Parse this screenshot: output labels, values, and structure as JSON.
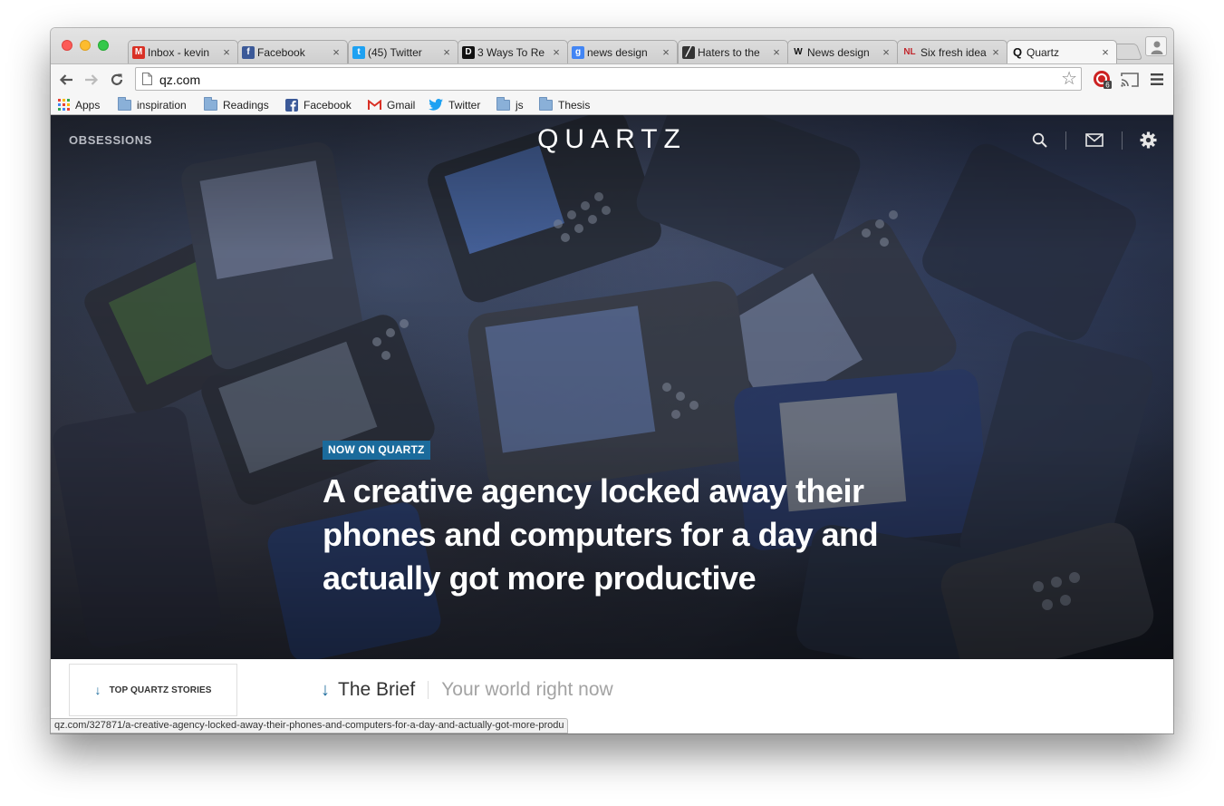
{
  "browser": {
    "tabs": [
      {
        "title": "Inbox - kevin",
        "favicon": "gmail-icon",
        "color": "#d93025",
        "glyph": "M"
      },
      {
        "title": "Facebook",
        "favicon": "facebook-icon",
        "color": "#3b5998",
        "glyph": "f"
      },
      {
        "title": "(45) Twitter",
        "favicon": "twitter-icon",
        "color": "#1da1f2",
        "glyph": "t"
      },
      {
        "title": "3 Ways To Re",
        "favicon": "d-logo-icon",
        "color": "#111111",
        "glyph": "D"
      },
      {
        "title": "news design",
        "favicon": "google-icon",
        "color": "#4285f4",
        "glyph": "g"
      },
      {
        "title": "Haters to the",
        "favicon": "stripe-logo-icon",
        "color": "#333333",
        "glyph": "╱"
      },
      {
        "title": "News design",
        "favicon": "wikipedia-icon",
        "color": "#ffffff",
        "glyph": "W"
      },
      {
        "title": "Six fresh idea",
        "favicon": "niemanlab-icon",
        "color": "#ffffff",
        "glyph": "NL"
      },
      {
        "title": "Quartz",
        "favicon": "quartz-icon",
        "color": "#ffffff",
        "glyph": "Q"
      }
    ],
    "active_tab_index": 8,
    "url": "qz.com",
    "extension_badge": "6",
    "bookmarks": [
      {
        "label": "Apps",
        "icon": "apps-grid-icon"
      },
      {
        "label": "inspiration",
        "icon": "folder-icon"
      },
      {
        "label": "Readings",
        "icon": "folder-icon"
      },
      {
        "label": "Facebook",
        "icon": "facebook-icon"
      },
      {
        "label": "Gmail",
        "icon": "gmail-icon"
      },
      {
        "label": "Twitter",
        "icon": "twitter-icon"
      },
      {
        "label": "js",
        "icon": "folder-icon"
      },
      {
        "label": "Thesis",
        "icon": "folder-icon"
      }
    ],
    "status_url": "qz.com/327871/a-creative-agency-locked-away-their-phones-and-computers-for-a-day-and-actually-got-more-produ"
  },
  "site": {
    "obsessions_label": "OBSESSIONS",
    "logo": "QUARTZ",
    "kicker": "NOW ON QUARTZ",
    "headline": "A creative agency locked away their phones and computers for a day and actually got more productive",
    "top_stories_label": "TOP QUARTZ STORIES",
    "brief_title": "The Brief",
    "brief_subtitle": "Your world right now",
    "accent_color": "#1b6b9c"
  }
}
